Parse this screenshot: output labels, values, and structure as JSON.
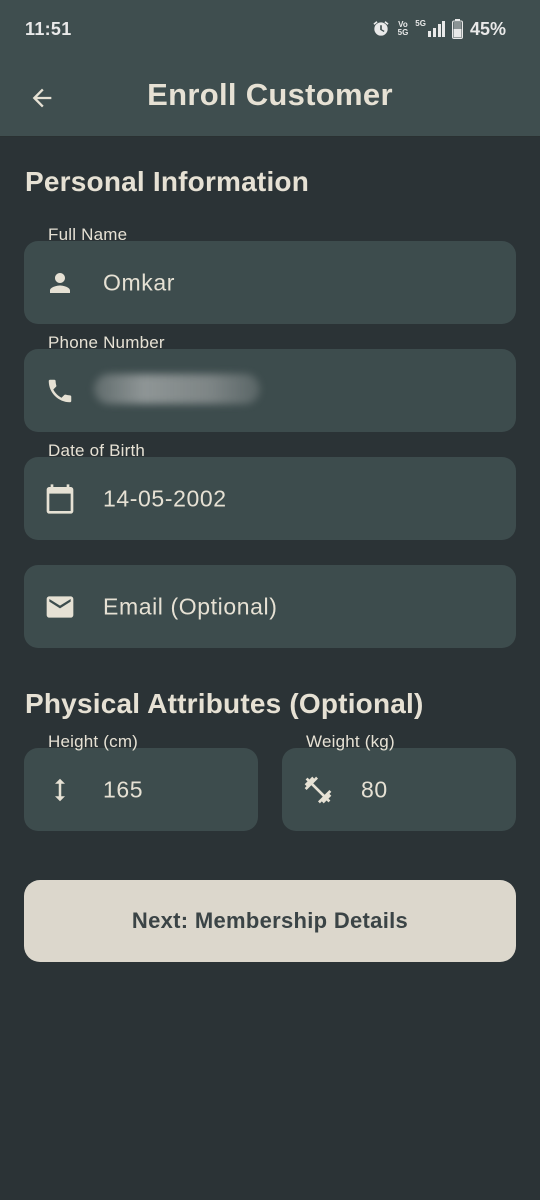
{
  "status_bar": {
    "time": "11:51",
    "network_labels": [
      "Vo",
      "5G"
    ],
    "signal_label": "5G",
    "battery": "45%"
  },
  "app_bar": {
    "title": "Enroll Customer",
    "back_icon": "arrow-left-icon"
  },
  "personal": {
    "section_title": "Personal Information",
    "full_name": {
      "label": "Full Name",
      "value": "Omkar",
      "icon": "person-icon"
    },
    "phone": {
      "label": "Phone Number",
      "value": "",
      "icon": "phone-icon"
    },
    "dob": {
      "label": "Date of Birth",
      "value": "14-05-2002",
      "icon": "calendar-icon"
    },
    "email": {
      "placeholder": "Email (Optional)",
      "icon": "mail-icon"
    }
  },
  "physical": {
    "section_title": "Physical Attributes (Optional)",
    "height": {
      "label": "Height (cm)",
      "value": "165",
      "icon": "height-icon"
    },
    "weight": {
      "label": "Weight (kg)",
      "value": "80",
      "icon": "dumbbell-icon"
    }
  },
  "actions": {
    "next_label": "Next: Membership Details"
  },
  "colors": {
    "background": "#2b3336",
    "bar": "#3f4e4f",
    "field": "#3d4c4d",
    "text": "#e6e1d4",
    "button": "#dcd7cc",
    "button_text": "#3b4446"
  }
}
